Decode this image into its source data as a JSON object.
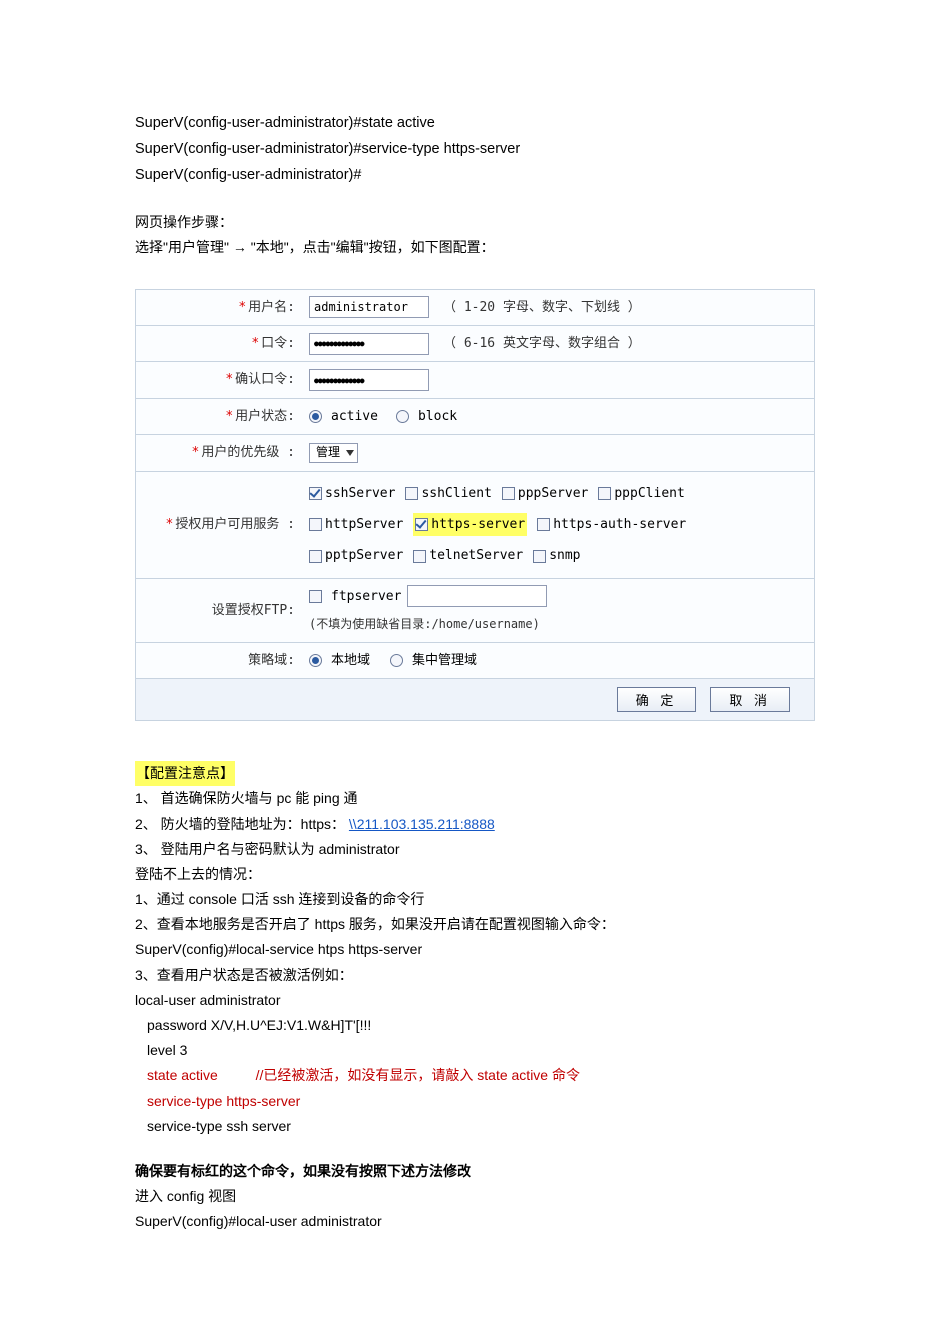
{
  "cli": {
    "l1": "SuperV(config-user-administrator)#state active",
    "l2": "SuperV(config-user-administrator)#service-type https-server",
    "l3": "SuperV(config-user-administrator)#"
  },
  "intro": {
    "steps_title": "网页操作步骤：",
    "nav_line_p1": "选择\"用户管理\"",
    "nav_line_p2": "\"本地\"，点击\"编辑\"按钮，如下图配置：",
    "arrow": "→"
  },
  "form": {
    "labels": {
      "user": "用户名:",
      "pwd": "口令:",
      "pwd2": "确认口令:",
      "state": "用户状态:",
      "level": "用户的优先级 :",
      "services": "授权用户可用服务 :",
      "ftp": "设置授权FTP:",
      "policy": "策略域:"
    },
    "values": {
      "user": "administrator",
      "pwd_mask": "●●●●●●●●●●●●●",
      "pwd2_mask": "●●●●●●●●●●●●●",
      "level": "管理"
    },
    "hints": {
      "user": "（ 1-20 字母、数字、下划线 ）",
      "pwd": "（ 6-16 英文字母、数字组合 ）",
      "ftp_note": "(不填为使用缺省目录:/home/username)"
    },
    "state": {
      "active": "active",
      "block": "block"
    },
    "services": {
      "ssh_server": "sshServer",
      "ssh_client": "sshClient",
      "ppp_server": "pppServer",
      "ppp_client": "pppClient",
      "http_server": "httpServer",
      "https_server": "https-server",
      "https_auth": "https-auth-server",
      "pptp_server": "pptpServer",
      "telnet_server": "telnetServer",
      "snmp": "snmp",
      "ftp_server": "ftpserver"
    },
    "policy": {
      "local": "本地域",
      "central": "集中管理域"
    },
    "buttons": {
      "ok": "确 定",
      "cancel": "取 消"
    }
  },
  "notes": {
    "title": "【配置注意点】",
    "n1": "1、 首选确保防火墙与 pc 能 ping 通",
    "n2a": "2、 防火墙的登陆地址为：https：",
    "n2_link": "\\\\211.103.135.211:8888",
    "n3": "3、 登陆用户名与密码默认为 administrator",
    "fail_title": "登陆不上去的情况：",
    "f1": "1、通过 console 口活 ssh 连接到设备的命令行",
    "f2": "2、查看本地服务是否开启了 https 服务，如果没开启请在配置视图输入命令：",
    "f2_cmd": "SuperV(config)#local-service htps https-server",
    "f3": "3、查看用户状态是否被激活例如：",
    "f3_l1": "local-user administrator",
    "f3_l2": "password    X/V,H.U^EJ:V1.W&H]T'[!!!",
    "f3_l3": "level 3",
    "f3_l4a": "state active",
    "f3_l4b": "//已经被激活，如没有显示，请敲入 state active 命令",
    "f3_l5": "service-type https-server",
    "f3_l6": "service-type ssh server",
    "ensure": "确保要有标红的这个命令，如果没有按照下述方法修改",
    "enter": "进入 config 视图",
    "last": "SuperV(config)#local-user administrator"
  }
}
